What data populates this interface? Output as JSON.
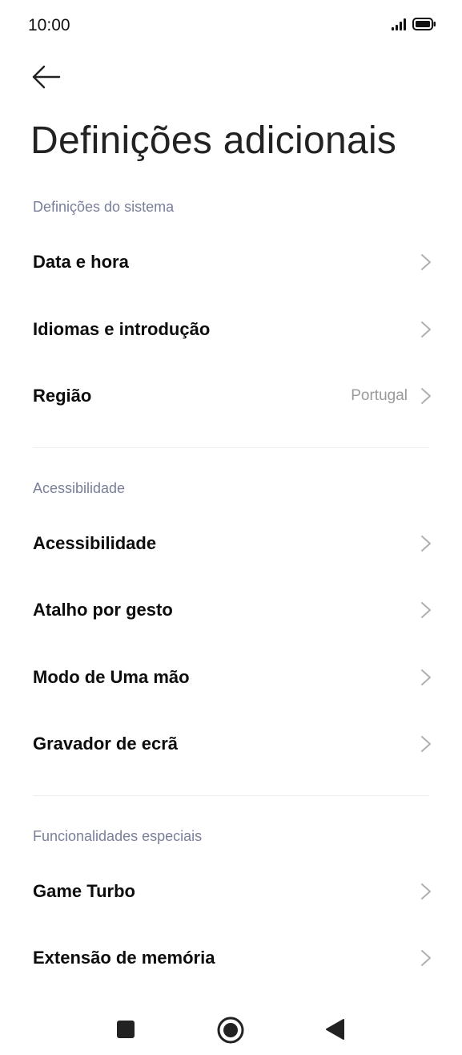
{
  "status_bar": {
    "time": "10:00"
  },
  "header": {
    "back_icon": "arrow-left-icon",
    "title": "Definições adicionais"
  },
  "sections": [
    {
      "title": "Definições do sistema",
      "items": [
        {
          "label": "Data e hora"
        },
        {
          "label": "Idiomas e introdução"
        },
        {
          "label": "Região",
          "value": "Portugal"
        }
      ]
    },
    {
      "title": "Acessibilidade",
      "items": [
        {
          "label": "Acessibilidade"
        },
        {
          "label": "Atalho por gesto"
        },
        {
          "label": "Modo de Uma mão"
        },
        {
          "label": "Gravador de ecrã"
        }
      ]
    },
    {
      "title": "Funcionalidades especiais",
      "items": [
        {
          "label": "Game Turbo"
        },
        {
          "label": "Extensão de memória"
        }
      ]
    }
  ],
  "nav_bar": {
    "recents_icon": "square-recents-icon",
    "home_icon": "circle-home-icon",
    "back_icon": "triangle-back-icon"
  },
  "colors": {
    "background": "#ffffff",
    "section_header": "#7a7f99",
    "chevron": "#b0b0b0",
    "value_text": "#9a9a9a"
  }
}
